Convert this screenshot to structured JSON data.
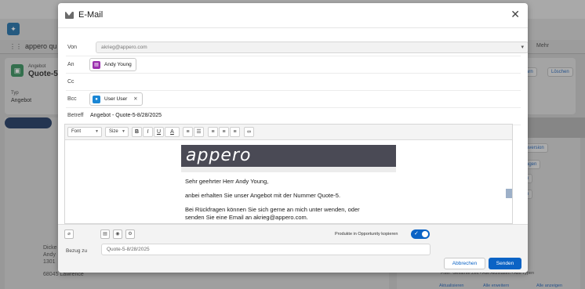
{
  "background": {
    "app_name": "appero qu",
    "record_type": "Angebot",
    "record_name": "Quote-5-",
    "field_label": "Typ",
    "field_value": "Angebot",
    "more_button": "Mehr",
    "edit_button": "arn",
    "delete_button": "Löschen",
    "right_buttons": [
      "aversion",
      "agen",
      "n",
      "n"
    ],
    "address_lines": [
      "Dicke",
      "Andy",
      "1301",
      "68045 Lawrence"
    ],
    "filter_text": "Filter: Gesamte Zeit • Alle Aktivitäten • Alle Typen",
    "footer_links": [
      "Aktualisieren",
      "Alle erweitern",
      "Alle anzeigen"
    ]
  },
  "modal": {
    "title": "E-Mail",
    "close_icon": "close-icon",
    "from": {
      "label": "Von",
      "value": "akrieg@appero.com"
    },
    "to": {
      "label": "An",
      "recipient": "Andy Young"
    },
    "cc": {
      "label": "Cc"
    },
    "bcc": {
      "label": "Bcc",
      "recipient": "User User"
    },
    "subject": {
      "label": "Betreff",
      "value": "Angebot - Quote-5-8/28/2025"
    },
    "toolbar": {
      "font": "Font",
      "size": "Size",
      "bold": "B",
      "italic": "I",
      "underline": "U",
      "color": "A"
    },
    "body": {
      "logo_text": "appero",
      "greeting": "Sehr geehrter Herr Andy Young,",
      "line1": "anbei erhalten Sie unser Angebot mit der Nummer Quote-5.",
      "line2": "Bei Rückfragen können Sie sich gerne an mich unter wenden, oder",
      "line3": "senden Sie eine Email an akrieg@appero.com."
    },
    "footer": {
      "toggle_label": "Produkte in Opportunity kopieren",
      "toggle_on": true,
      "related_label": "Bezug zu",
      "related_value": "Quote-5-8/28/2025",
      "cancel": "Abbrechen",
      "send": "Senden"
    }
  },
  "colors": {
    "brand_blue": "#0b63c5",
    "logo_bg": "#4a4a55",
    "contact_icon": "#9b2fae",
    "user_icon": "#1a86d4"
  }
}
